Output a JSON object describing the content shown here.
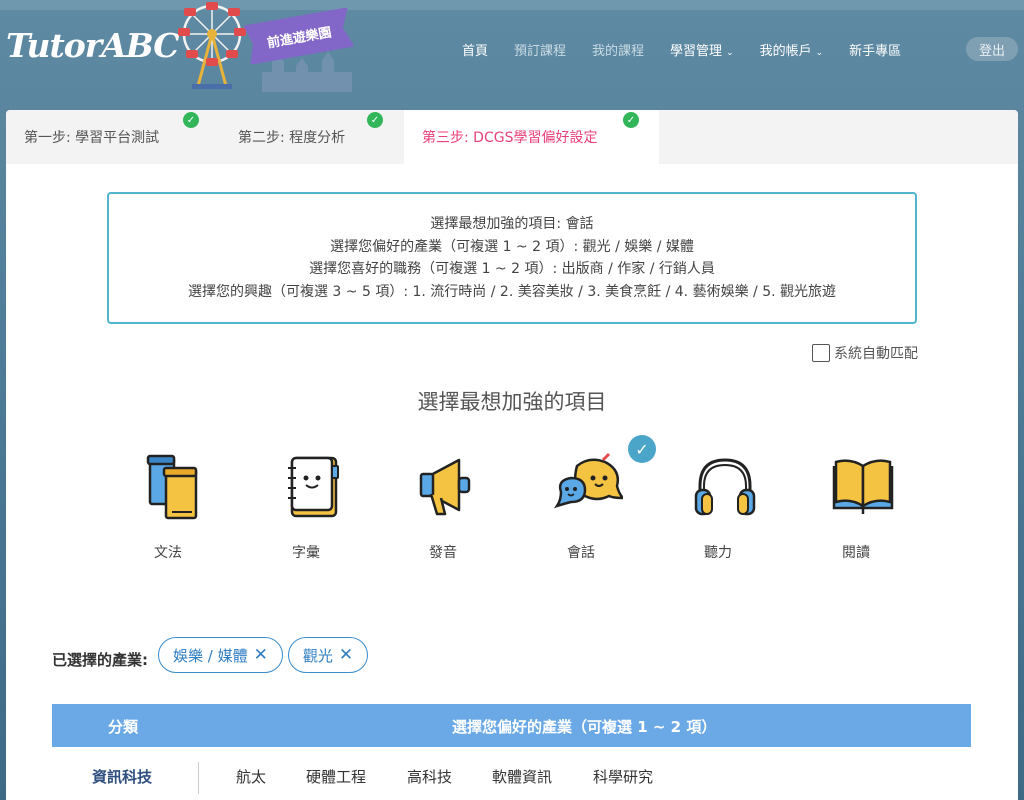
{
  "header": {
    "logo": "TutorABC",
    "banner": "前進遊樂園",
    "nav": [
      {
        "label": "首頁",
        "dim": false,
        "dropdown": false
      },
      {
        "label": "預訂課程",
        "dim": true,
        "dropdown": false
      },
      {
        "label": "我的課程",
        "dim": true,
        "dropdown": false
      },
      {
        "label": "學習管理",
        "dim": false,
        "dropdown": true
      },
      {
        "label": "我的帳戶",
        "dim": false,
        "dropdown": true
      },
      {
        "label": "新手專區",
        "dim": false,
        "dropdown": false
      }
    ],
    "logout": "登出"
  },
  "steps": [
    {
      "label": "第一步:  學習平台測試",
      "done": true,
      "active": false
    },
    {
      "label": "第二步:  程度分析",
      "done": true,
      "active": false
    },
    {
      "label": "第三步:  DCGS學習偏好設定",
      "done": true,
      "active": true
    }
  ],
  "summary": [
    "選擇最想加強的項目:  會話",
    "選擇您偏好的產業（可複選 1 ~ 2 項）:  觀光 / 娛樂 / 媒體",
    "選擇您喜好的職務（可複選 1 ~ 2 項）:  出版商 / 作家 / 行銷人員",
    "選擇您的興趣（可複選 3 ~ 5 項）:  1. 流行時尚 / 2. 美容美妝 / 3. 美食烹飪 / 4. 藝術娛樂 / 5. 觀光旅遊"
  ],
  "auto_match": {
    "label": "系統自動匹配",
    "checked": false
  },
  "section_title": "選擇最想加強的項目",
  "skills": [
    {
      "label": "文法",
      "icon": "books-icon",
      "selected": false
    },
    {
      "label": "字彙",
      "icon": "notebook-icon",
      "selected": false
    },
    {
      "label": "發音",
      "icon": "megaphone-icon",
      "selected": false
    },
    {
      "label": "會話",
      "icon": "chat-bubbles-icon",
      "selected": true
    },
    {
      "label": "聽力",
      "icon": "headphones-icon",
      "selected": false
    },
    {
      "label": "閱讀",
      "icon": "open-book-icon",
      "selected": false
    }
  ],
  "chosen": {
    "label": "已選擇的產業:",
    "chips": [
      "娛樂 / 媒體",
      "觀光"
    ]
  },
  "table": {
    "col_category": "分類",
    "col_industry": "選擇您偏好的產業（可複選 1 ~ 2 項）",
    "rows": [
      {
        "category": "資訊科技",
        "industries": [
          "航太",
          "硬體工程",
          "高科技",
          "軟體資訊",
          "科學研究"
        ]
      }
    ]
  },
  "colors": {
    "accent_pink": "#e8417a",
    "border_teal": "#52b5cd",
    "table_blue": "#6aa9e6",
    "check_green": "#33b65a"
  }
}
